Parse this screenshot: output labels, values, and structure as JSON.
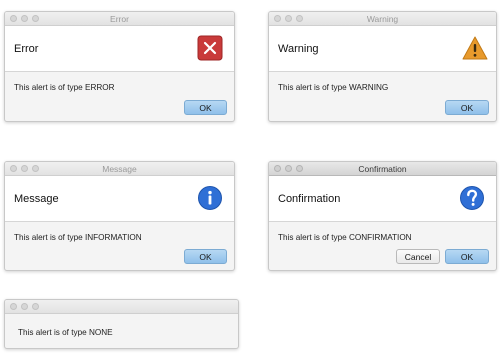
{
  "dialogs": {
    "error": {
      "window_title": "Error",
      "header": "Error",
      "content": "This alert is of type ERROR",
      "ok_label": "OK",
      "icon": "error-icon",
      "icon_color": "#c93a3a"
    },
    "warning": {
      "window_title": "Warning",
      "header": "Warning",
      "content": "This alert is of type WARNING",
      "ok_label": "OK",
      "icon": "warning-icon",
      "icon_color": "#e89a2c"
    },
    "information": {
      "window_title": "Message",
      "header": "Message",
      "content": "This alert is of type INFORMATION",
      "ok_label": "OK",
      "icon": "info-icon",
      "icon_color": "#2f6fd6"
    },
    "confirmation": {
      "window_title": "Confirmation",
      "header": "Confirmation",
      "content": "This alert is of type CONFIRMATION",
      "cancel_label": "Cancel",
      "ok_label": "OK",
      "icon": "question-icon",
      "icon_color": "#2f6fd6"
    },
    "none": {
      "content": "This alert is of type NONE"
    }
  },
  "colors": {
    "primary_button": "#9ccaee",
    "dialog_background": "#f4f4f4",
    "header_background": "#ffffff"
  }
}
